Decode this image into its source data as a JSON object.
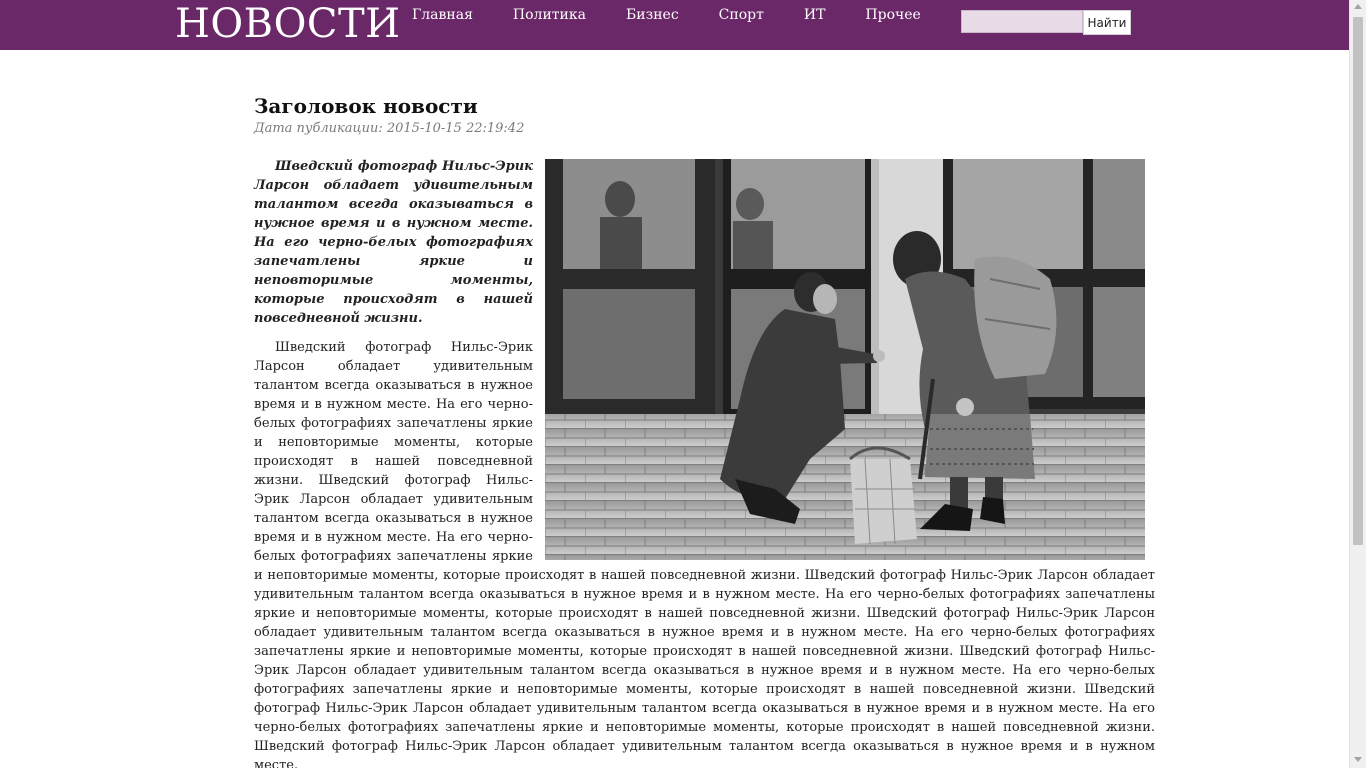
{
  "header": {
    "logo": "НОВОСТИ",
    "nav": [
      "Главная",
      "Политика",
      "Бизнес",
      "Спорт",
      "ИТ",
      "Прочее"
    ],
    "search_placeholder": "",
    "search_button": "Найти"
  },
  "article": {
    "title": "Заголовок новости",
    "date": "Дата публикации: 2015-10-15 22:19:42",
    "lead": "Шведский фотограф Нильс-Эрик Ларсон обладает удивительным талантом всегда оказываться в нужное время и в нужном месте. На его черно-белых фотографиях запечатлены яркие и неповторимые моменты, которые происходят в нашей повседневной жизни.",
    "body": "Шведский фотограф Нильс-Эрик Ларсон обладает удивительным талантом всегда оказываться в нужное время и в нужном месте. На его черно-белых фотографиях запечатлены яркие и неповторимые моменты, которые происходят в нашей повседневной жизни. Шведский фотограф Нильс-Эрик Ларсон обладает удивительным талантом всегда оказываться в нужное время и в нужном месте. На его черно-белых фотографиях запечатлены яркие и неповторимые моменты, которые происходят в нашей повседневной жизни. Шведский фотограф Нильс-Эрик Ларсон обладает удивительным талантом всегда оказываться в нужное время и в нужном месте. На его черно-белых фотографиях запечатлены яркие и неповторимые моменты, которые происходят в нашей повседневной жизни. Шведский фотограф Нильс-Эрик Ларсон обладает удивительным талантом всегда оказываться в нужное время и в нужном месте. На его черно-белых фотографиях запечатлены яркие и неповторимые моменты, которые происходят в нашей повседневной жизни. Шведский фотограф Нильс-Эрик Ларсон обладает удивительным талантом всегда оказываться в нужное время и в нужном месте. На его черно-белых фотографиях запечатлены яркие и неповторимые моменты, которые происходят в нашей повседневной жизни. Шведский фотограф Нильс-Эрик Ларсон обладает удивительным талантом всегда оказываться в нужное время и в нужном месте. На его черно-белых фотографиях запечатлены яркие и неповторимые моменты, которые происходят в нашей повседневной жизни. Шведский фотограф Нильс-Эрик Ларсон обладает удивительным талантом всегда оказываться в нужное время и в нужном месте."
  },
  "colors": {
    "header_bg": "#6b2868",
    "header_text": "#ffffff",
    "search_input_bg": "#e9dbe7",
    "date_text": "#7a7a7a"
  }
}
